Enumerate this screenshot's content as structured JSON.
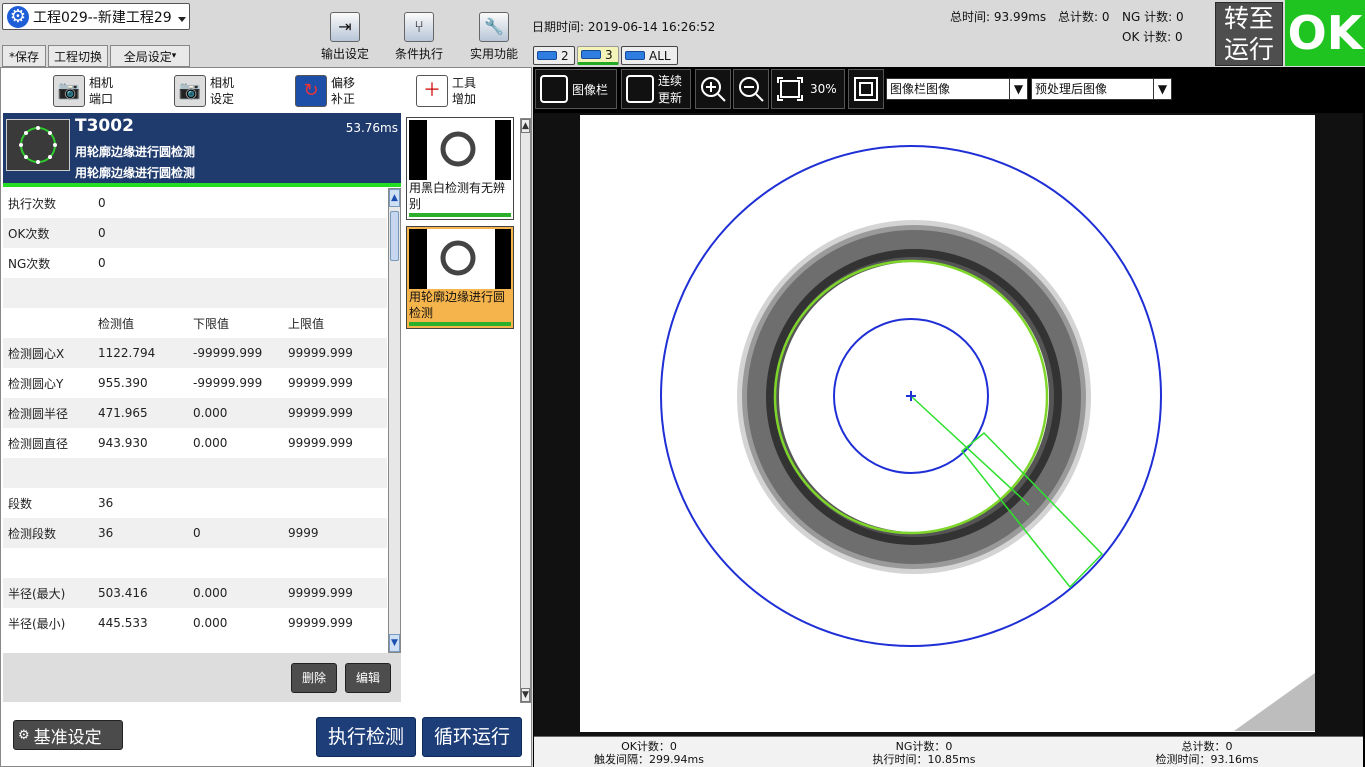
{
  "header": {
    "project": "工程029--新建工程29",
    "save": "*保存",
    "switch": "工程切换",
    "global": "全局设定",
    "datetime": "日期时间: 2019-06-14 16:26:52",
    "tools": [
      "输出设定",
      "条件执行",
      "实用功能"
    ],
    "total_time": "总时间:  93.99ms",
    "total_count": "总计数: 0",
    "ng_count": "NG 计数: 0",
    "ok_count": "OK 计数: 0",
    "turn": "转至",
    "run": "运行",
    "result": "OK",
    "accent": "#1fc421",
    "cam_tabs": [
      {
        "label": "2"
      },
      {
        "label": "3"
      },
      {
        "label": "ALL"
      }
    ]
  },
  "left": {
    "tools": [
      {
        "l1": "相机",
        "l2": "端口",
        "icon": "camera-port-icon"
      },
      {
        "l1": "相机",
        "l2": "设定",
        "icon": "camera-settings-icon"
      },
      {
        "l1": "偏移",
        "l2": "补正",
        "icon": "offset-correction-icon"
      },
      {
        "l1": "工具",
        "l2": "增加",
        "icon": "tool-add-icon"
      }
    ],
    "step": {
      "id": "T3002",
      "time": "53.76ms",
      "name1": "用轮廓边缘进行圆检测",
      "name2": "用轮廓边缘进行圆检测"
    },
    "rows": [
      {
        "a": "执行次数",
        "b": "0",
        "c": "",
        "d": ""
      },
      {
        "a": "OK次数",
        "b": "0",
        "c": "",
        "d": ""
      },
      {
        "a": "NG次数",
        "b": "0",
        "c": "",
        "d": ""
      },
      {
        "a": "",
        "b": "",
        "c": "",
        "d": ""
      },
      {
        "a": "",
        "b": "检测值",
        "c": "下限值",
        "d": "上限值"
      },
      {
        "a": "检测圆心X",
        "b": "1122.794",
        "c": "-99999.999",
        "d": "99999.999"
      },
      {
        "a": "检测圆心Y",
        "b": "955.390",
        "c": "-99999.999",
        "d": "99999.999"
      },
      {
        "a": "检测圆半径",
        "b": "471.965",
        "c": "0.000",
        "d": "99999.999"
      },
      {
        "a": "检测圆直径",
        "b": "943.930",
        "c": "0.000",
        "d": "99999.999"
      },
      {
        "a": "",
        "b": "",
        "c": "",
        "d": ""
      },
      {
        "a": "段数",
        "b": "36",
        "c": "",
        "d": ""
      },
      {
        "a": "检测段数",
        "b": "36",
        "c": "0",
        "d": "9999"
      },
      {
        "a": "",
        "b": "",
        "c": "",
        "d": ""
      },
      {
        "a": "半径(最大)",
        "b": "503.416",
        "c": "0.000",
        "d": "99999.999"
      },
      {
        "a": "半径(最小)",
        "b": "445.533",
        "c": "0.000",
        "d": "99999.999"
      }
    ],
    "delete": "删除",
    "edit": "编辑",
    "base": "基准设定",
    "exec": "执行检测",
    "loop": "循环运行",
    "cards": [
      {
        "label": "用黑白检测有无辨别"
      },
      {
        "label": "用轮廓边缘进行圆检测"
      }
    ]
  },
  "right": {
    "imgbar": "图像栏",
    "cont1": "连续",
    "cont2": "更新",
    "zoom": "30%",
    "combo1": "图像栏图像",
    "combo2": "预处理后图像",
    "ok": "OK计数：0",
    "trigger": "触发间隔：299.94ms",
    "ng": "NG计数：0",
    "exec": "执行时间：10.85ms",
    "total": "总计数：0",
    "detect": "检测时间：93.16ms"
  }
}
